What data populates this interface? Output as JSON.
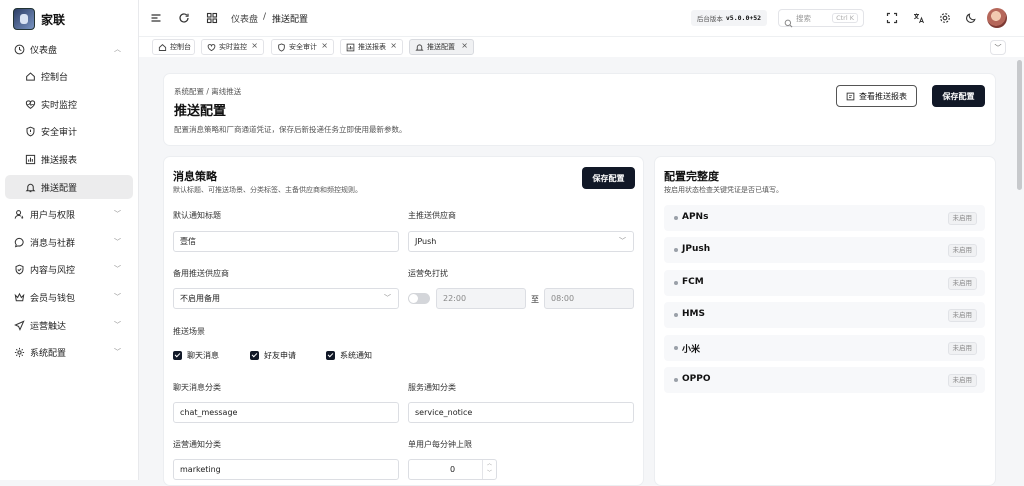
{
  "app": {
    "name": "家联"
  },
  "sidebar": {
    "items": [
      {
        "label": "仪表盘",
        "icon": "clock-icon"
      },
      {
        "label": "控制台",
        "icon": "home-icon"
      },
      {
        "label": "实时监控",
        "icon": "heart-pulse-icon"
      },
      {
        "label": "安全审计",
        "icon": "shield-alert-icon"
      },
      {
        "label": "推送报表",
        "icon": "bar-chart-icon"
      },
      {
        "label": "推送配置",
        "icon": "bell-icon"
      },
      {
        "label": "用户与权限",
        "icon": "user-key-icon"
      },
      {
        "label": "消息与社群",
        "icon": "chat-bubble-icon"
      },
      {
        "label": "内容与风控",
        "icon": "shield-check-icon"
      },
      {
        "label": "会员与钱包",
        "icon": "crown-icon"
      },
      {
        "label": "运营触达",
        "icon": "send-icon"
      },
      {
        "label": "系统配置",
        "icon": "gear-icon"
      }
    ]
  },
  "header": {
    "crumb_parent": "仪表盘",
    "crumb_sep": "/",
    "crumb_current": "推送配置",
    "version_label": "后台版本",
    "version_value": "v5.0.0+52",
    "search_placeholder": "搜索",
    "search_shortcut": "Ctrl K"
  },
  "tabs": [
    {
      "label": "控制台",
      "icon": "home-icon",
      "closable": false
    },
    {
      "label": "实时监控",
      "icon": "heart-pulse-icon",
      "closable": true
    },
    {
      "label": "安全审计",
      "icon": "shield-alert-icon",
      "closable": true
    },
    {
      "label": "推送报表",
      "icon": "bar-chart-icon",
      "closable": true
    },
    {
      "label": "推送配置",
      "icon": "bell-icon",
      "closable": true,
      "active": true
    }
  ],
  "page": {
    "breadcrumb": "系统配置 / 离线推送",
    "title": "推送配置",
    "description": "配置消息策略和厂商通道凭证，保存后新投递任务立即使用最新参数。",
    "view_report_btn": "查看推送报表",
    "save_btn": "保存配置"
  },
  "strategy": {
    "title": "消息策略",
    "subtitle": "默认标题、可推送场景、分类标签、主备供应商和频控规则。",
    "save_btn": "保存配置",
    "default_title_label": "默认通知标题",
    "default_title_value": "壹信",
    "primary_provider_label": "主推送供应商",
    "primary_provider_value": "JPush",
    "backup_provider_label": "备用推送供应商",
    "backup_provider_value": "不启用备用",
    "dnd_label": "运营免打扰",
    "dnd_start": "22:00",
    "dnd_to": "至",
    "dnd_end": "08:00",
    "dnd_enabled": false,
    "scenes_label": "推送场景",
    "scenes": [
      {
        "label": "聊天消息",
        "checked": true
      },
      {
        "label": "好友申请",
        "checked": true
      },
      {
        "label": "系统通知",
        "checked": true
      }
    ],
    "chat_category_label": "聊天消息分类",
    "chat_category_value": "chat_message",
    "service_category_label": "服务通知分类",
    "service_category_value": "service_notice",
    "ops_category_label": "运营通知分类",
    "ops_category_value": "marketing",
    "rate_limit_label": "单用户每分钟上限",
    "rate_limit_value": "0"
  },
  "completeness": {
    "title": "配置完整度",
    "subtitle": "按启用状态检查关键凭证是否已填写。",
    "providers": [
      {
        "name": "APNs",
        "status": "未启用"
      },
      {
        "name": "JPush",
        "status": "未启用"
      },
      {
        "name": "FCM",
        "status": "未启用"
      },
      {
        "name": "HMS",
        "status": "未启用"
      },
      {
        "name": "小米",
        "status": "未启用"
      },
      {
        "name": "OPPO",
        "status": "未启用"
      }
    ]
  }
}
